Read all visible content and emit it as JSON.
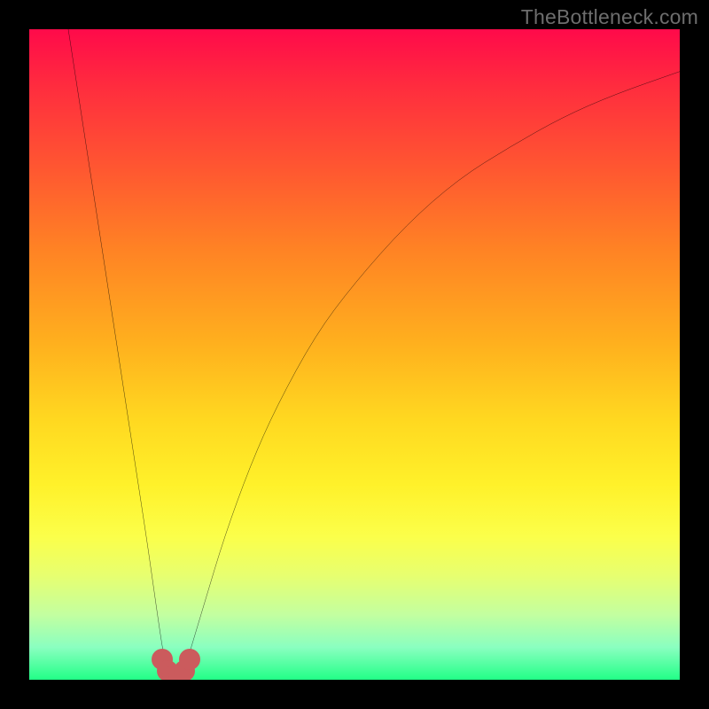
{
  "watermark": "TheBottleneck.com",
  "chart_data": {
    "type": "line",
    "title": "",
    "xlabel": "",
    "ylabel": "",
    "xlim": [
      0,
      100
    ],
    "ylim": [
      0,
      100
    ],
    "background_gradient": {
      "direction": "top-to-bottom",
      "stops": [
        {
          "pos": 0,
          "color": "#ff0a4a"
        },
        {
          "pos": 9,
          "color": "#ff2d3e"
        },
        {
          "pos": 22,
          "color": "#ff5930"
        },
        {
          "pos": 34,
          "color": "#ff8324"
        },
        {
          "pos": 48,
          "color": "#ffaf1e"
        },
        {
          "pos": 60,
          "color": "#ffd820"
        },
        {
          "pos": 70,
          "color": "#fff12a"
        },
        {
          "pos": 78,
          "color": "#fbff4a"
        },
        {
          "pos": 84,
          "color": "#e7ff70"
        },
        {
          "pos": 90,
          "color": "#c3ffa0"
        },
        {
          "pos": 95,
          "color": "#8affc0"
        },
        {
          "pos": 100,
          "color": "#22ff87"
        }
      ]
    },
    "series": [
      {
        "name": "curve",
        "color": "#000000",
        "points": [
          {
            "x": 6.0,
            "y": 100.0
          },
          {
            "x": 8.0,
            "y": 87.0
          },
          {
            "x": 10.0,
            "y": 74.0
          },
          {
            "x": 12.0,
            "y": 61.0
          },
          {
            "x": 14.0,
            "y": 48.0
          },
          {
            "x": 16.0,
            "y": 35.0
          },
          {
            "x": 18.0,
            "y": 22.0
          },
          {
            "x": 19.0,
            "y": 15.0
          },
          {
            "x": 20.0,
            "y": 8.0
          },
          {
            "x": 20.7,
            "y": 3.5
          },
          {
            "x": 21.6,
            "y": 1.0
          },
          {
            "x": 22.5,
            "y": 0.2
          },
          {
            "x": 23.4,
            "y": 1.0
          },
          {
            "x": 24.3,
            "y": 3.0
          },
          {
            "x": 25.5,
            "y": 7.0
          },
          {
            "x": 27.0,
            "y": 12.0
          },
          {
            "x": 30.0,
            "y": 22.0
          },
          {
            "x": 34.0,
            "y": 33.0
          },
          {
            "x": 38.0,
            "y": 42.0
          },
          {
            "x": 44.0,
            "y": 53.0
          },
          {
            "x": 50.0,
            "y": 61.0
          },
          {
            "x": 58.0,
            "y": 70.0
          },
          {
            "x": 66.0,
            "y": 77.0
          },
          {
            "x": 74.0,
            "y": 82.0
          },
          {
            "x": 82.0,
            "y": 86.5
          },
          {
            "x": 90.0,
            "y": 90.0
          },
          {
            "x": 100.0,
            "y": 93.5
          }
        ]
      },
      {
        "name": "markers",
        "color": "#cb5b5d",
        "points": [
          {
            "x": 20.5,
            "y": 3.2
          },
          {
            "x": 21.2,
            "y": 1.3
          },
          {
            "x": 22.1,
            "y": 0.5
          },
          {
            "x": 23.0,
            "y": 0.5
          },
          {
            "x": 23.9,
            "y": 1.3
          },
          {
            "x": 24.7,
            "y": 3.2
          }
        ]
      }
    ]
  }
}
